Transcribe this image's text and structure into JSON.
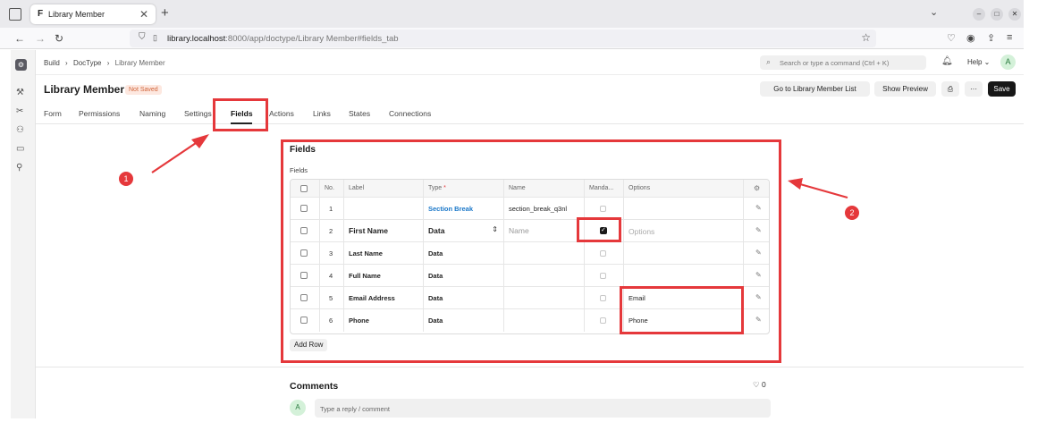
{
  "browser": {
    "tab_title": "Library Member",
    "tab_favicon": "F",
    "tab_close": "✕",
    "new_tab": "+",
    "url_host": "library.localhost",
    "url_rest": ":8000/app/doctype/Library Member#fields_tab"
  },
  "breadcrumb": [
    "Build",
    "DocType",
    "Library Member"
  ],
  "search": {
    "placeholder": "Search or type a command (Ctrl + K)"
  },
  "help_label": "Help",
  "user_initial": "A",
  "page": {
    "title": "Library Member",
    "status": "Not Saved",
    "buttons": {
      "go_to_list": "Go to Library Member List",
      "show_preview": "Show Preview",
      "more": "···",
      "save": "Save"
    }
  },
  "tabs": [
    "Form",
    "Permissions",
    "Naming",
    "Settings",
    "Fields",
    "Actions",
    "Links",
    "States",
    "Connections"
  ],
  "active_tab": "Fields",
  "fields_section": {
    "title": "Fields",
    "subtitle": "Fields",
    "columns": [
      "No.",
      "Label",
      "Type",
      "Name",
      "Manda...",
      "Options"
    ],
    "type_required_marker": "*",
    "rows": [
      {
        "no": "1",
        "label": "",
        "type": "Section Break",
        "name": "section_break_q3nl",
        "mandatory": false,
        "options": ""
      },
      {
        "no": "2",
        "label": "First Name",
        "type": "Data",
        "name": "Name",
        "mandatory": true,
        "options": "Options"
      },
      {
        "no": "3",
        "label": "Last Name",
        "type": "Data",
        "name": "",
        "mandatory": false,
        "options": ""
      },
      {
        "no": "4",
        "label": "Full Name",
        "type": "Data",
        "name": "",
        "mandatory": false,
        "options": ""
      },
      {
        "no": "5",
        "label": "Email Address",
        "type": "Data",
        "name": "",
        "mandatory": false,
        "options": "Email"
      },
      {
        "no": "6",
        "label": "Phone",
        "type": "Data",
        "name": "",
        "mandatory": false,
        "options": "Phone"
      }
    ],
    "add_row": "Add Row"
  },
  "comments": {
    "title": "Comments",
    "likes": "0",
    "placeholder": "Type a reply / comment",
    "avatar_initial": "A"
  },
  "annotations": {
    "marker_1": "1",
    "marker_2": "2",
    "color": "#e5383b"
  },
  "icons": [
    "tab-list-icon",
    "back-icon",
    "forward-icon",
    "reload-icon",
    "shield-icon",
    "star-icon",
    "pocket-icon",
    "account-icon",
    "extensions-icon",
    "menu-icon",
    "search-icon",
    "bell-icon",
    "printer-icon",
    "settings-gear-icon",
    "pencil-icon",
    "heart-icon",
    "sort-icon"
  ]
}
